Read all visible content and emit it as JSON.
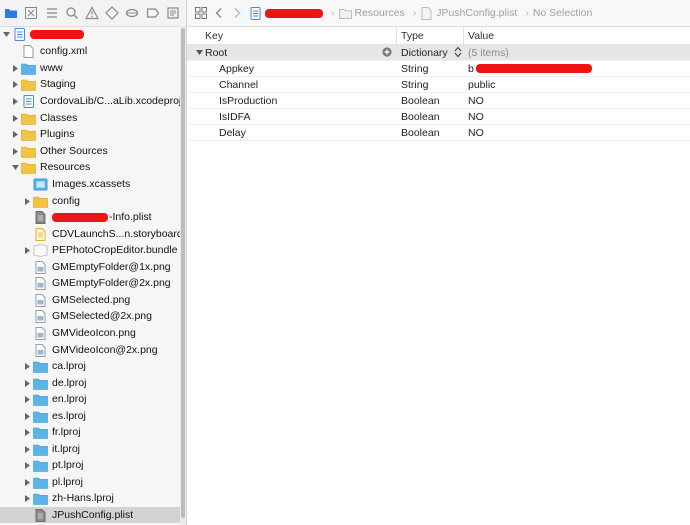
{
  "navigator": {
    "toolbar_icons": [
      "folder-icon",
      "source-control-icon",
      "hierarchy-icon",
      "search-icon",
      "issue-icon",
      "test-icon",
      "debug-icon",
      "breakpoint-icon",
      "report-icon"
    ],
    "project_name": "",
    "items": [
      {
        "label": "config.xml",
        "icon": "xml-file-icon"
      },
      {
        "label": "www",
        "icon": "folder-blue-icon"
      },
      {
        "label": "Staging",
        "icon": "folder-yellow-icon"
      },
      {
        "label": "CordovaLib/C...aLib.xcodeproj",
        "icon": "xcodeproj-icon"
      },
      {
        "label": "Classes",
        "icon": "folder-yellow-icon"
      },
      {
        "label": "Plugins",
        "icon": "folder-yellow-icon"
      },
      {
        "label": "Other Sources",
        "icon": "folder-yellow-icon"
      },
      {
        "label": "Resources",
        "icon": "folder-yellow-icon"
      },
      {
        "label": "Images.xcassets",
        "icon": "asset-catalog-icon"
      },
      {
        "label": "config",
        "icon": "folder-yellow-icon"
      },
      {
        "label": "-Info.plist",
        "icon": "plist-icon"
      },
      {
        "label": "CDVLaunchS...n.storyboard",
        "icon": "storyboard-icon"
      },
      {
        "label": "PEPhotoCropEditor.bundle",
        "icon": "bundle-icon"
      },
      {
        "label": "GMEmptyFolder@1x.png",
        "icon": "image-file-icon"
      },
      {
        "label": "GMEmptyFolder@2x.png",
        "icon": "image-file-icon"
      },
      {
        "label": "GMSelected.png",
        "icon": "image-file-icon"
      },
      {
        "label": "GMSelected@2x.png",
        "icon": "image-file-icon"
      },
      {
        "label": "GMVideoIcon.png",
        "icon": "image-file-icon"
      },
      {
        "label": "GMVideoIcon@2x.png",
        "icon": "image-file-icon"
      },
      {
        "label": "ca.lproj",
        "icon": "folder-blue-icon"
      },
      {
        "label": "de.lproj",
        "icon": "folder-blue-icon"
      },
      {
        "label": "en.lproj",
        "icon": "folder-blue-icon"
      },
      {
        "label": "es.lproj",
        "icon": "folder-blue-icon"
      },
      {
        "label": "fr.lproj",
        "icon": "folder-blue-icon"
      },
      {
        "label": "it.lproj",
        "icon": "folder-blue-icon"
      },
      {
        "label": "pt.lproj",
        "icon": "folder-blue-icon"
      },
      {
        "label": "pl.lproj",
        "icon": "folder-blue-icon"
      },
      {
        "label": "zh-Hans.lproj",
        "icon": "folder-blue-icon"
      },
      {
        "label": "JPushConfig.plist",
        "icon": "plist-icon"
      }
    ]
  },
  "jumpbar": {
    "crumbs": [
      "Resources",
      "JPushConfig.plist",
      "No Selection"
    ]
  },
  "plist": {
    "headers": {
      "key": "Key",
      "type": "Type",
      "value": "Value"
    },
    "root": {
      "key": "Root",
      "type": "Dictionary",
      "value": "(5 items)"
    },
    "rows": [
      {
        "key": "Appkey",
        "type": "String",
        "value": "b"
      },
      {
        "key": "Channel",
        "type": "String",
        "value": "public"
      },
      {
        "key": "IsProduction",
        "type": "Boolean",
        "value": "NO"
      },
      {
        "key": "IsIDFA",
        "type": "Boolean",
        "value": "NO"
      },
      {
        "key": "Delay",
        "type": "Boolean",
        "value": "NO"
      }
    ]
  },
  "colors": {
    "selection": "#d3d3d3",
    "folder_blue": "#5ab4e8",
    "folder_yellow": "#f5c342",
    "redaction": "#ee1414"
  }
}
